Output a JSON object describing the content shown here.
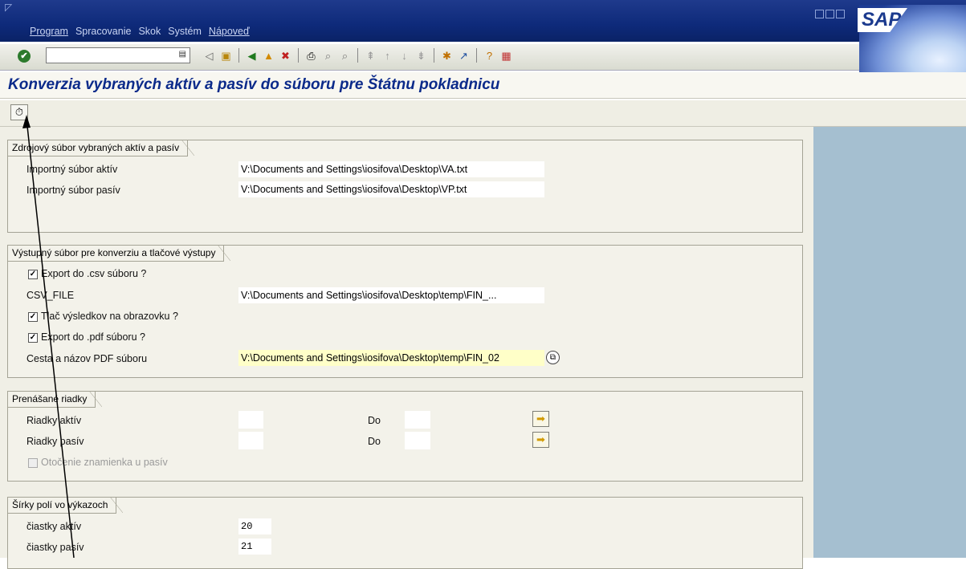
{
  "menu": {
    "items": [
      "Program",
      "Spracovanie",
      "Skok",
      "Systém",
      "Nápoveď"
    ]
  },
  "brand": {
    "logo_text": "SAP"
  },
  "icons": [
    "enter-icon",
    "save-icon",
    "back-icon",
    "exit-icon",
    "cancel-icon",
    "print-icon",
    "find-icon",
    "find-next-icon",
    "first-page-icon",
    "prev-page-icon",
    "next-page-icon",
    "last-page-icon",
    "create-session-icon",
    "shortcut-icon",
    "help-icon",
    "layout-icon"
  ],
  "page": {
    "title": "Konverzia vybraných aktív a pasív do súboru pre Štátnu pokladnicu"
  },
  "group_source": {
    "title": "Zdrojový súbor vybraných aktív a pasív",
    "assets_label": "Importný súbor aktív",
    "assets_value": "V:\\Documents and Settings\\iosifova\\Desktop\\VA.txt",
    "liab_label": "Importný súbor pasív",
    "liab_value": "V:\\Documents and Settings\\iosifova\\Desktop\\VP.txt"
  },
  "group_output": {
    "title": "Výstupný súbor pre konverziu a tlačové výstupy",
    "csv_check": "Export do .csv súboru ?",
    "csv_file_label": "CSV_FILE",
    "csv_file_value": "V:\\Documents and Settings\\iosifova\\Desktop\\temp\\FIN_...",
    "print_check": "Tlač výsledkov na obrazovku ?",
    "pdf_check": "Export do .pdf súboru ?",
    "pdf_path_label": "Cesta a názov PDF súboru",
    "pdf_path_value": "V:\\Documents and Settings\\iosifova\\Desktop\\temp\\FIN_02"
  },
  "group_rows": {
    "title": "Prenášané riadky",
    "assets_label": "Riadky aktív",
    "liab_label": "Riadky pasív",
    "to_label": "Do",
    "sign_check": "Otočenie znamienka u pasív"
  },
  "group_widths": {
    "title": "Šírky polí vo výkazoch",
    "amount_assets_label": "čiastky aktív",
    "amount_assets_value": "20",
    "amount_liab_label": "čiastky pasív",
    "amount_liab_value": "21"
  }
}
